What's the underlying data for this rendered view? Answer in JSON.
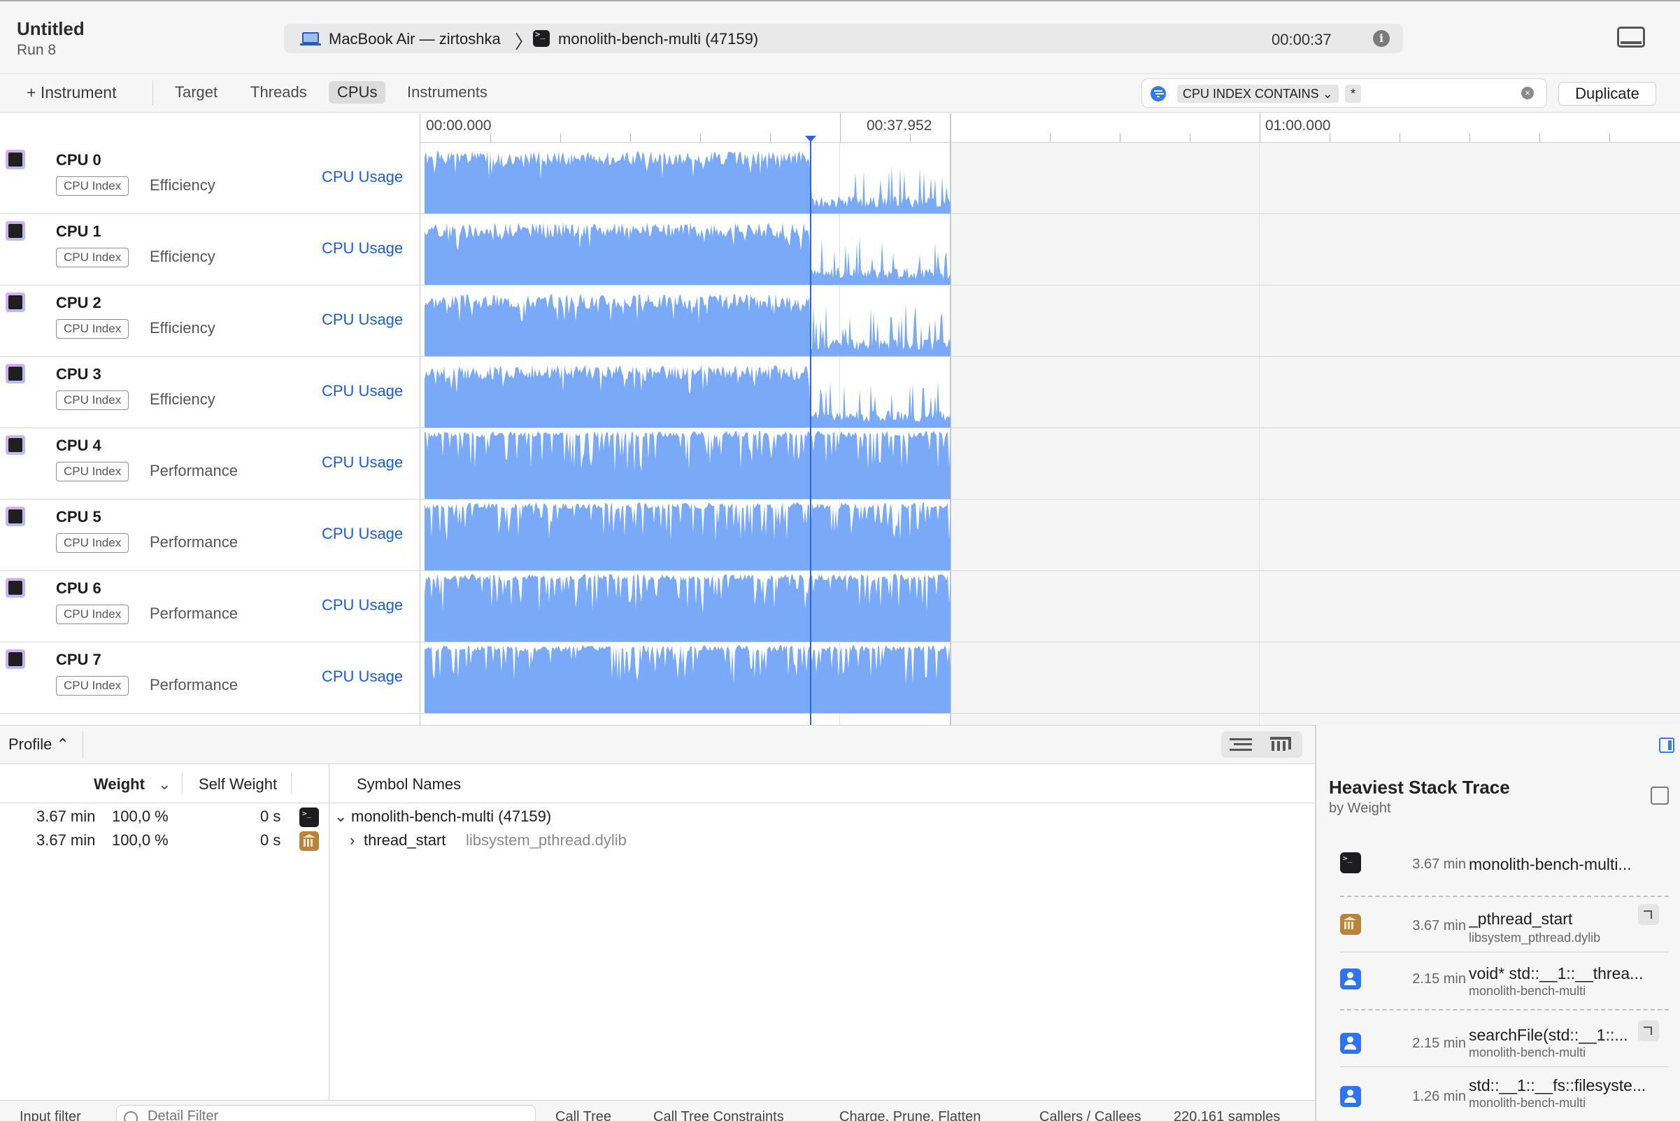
{
  "window": {
    "title": "Untitled",
    "run": "Run 8",
    "device": "MacBook Air — zirtoshka",
    "process": "monolith-bench-multi (47159)",
    "elapsed": "00:00:37"
  },
  "toolbar": {
    "add_instrument": "+ Instrument",
    "tabs": [
      "Target",
      "Threads",
      "CPUs",
      "Instruments"
    ],
    "active_tab": "CPUs",
    "filter_token": "CPU INDEX CONTAINS ⌄",
    "filter_value": "*",
    "duplicate_label": "Duplicate"
  },
  "ruler": {
    "start": "00:00.000",
    "mark": "00:37.952",
    "later": "01:00.000"
  },
  "tracks": [
    {
      "name": "CPU 0",
      "badge": "CPU Index",
      "cluster": "Efficiency",
      "instrument": "CPU Usage"
    },
    {
      "name": "CPU 1",
      "badge": "CPU Index",
      "cluster": "Efficiency",
      "instrument": "CPU Usage"
    },
    {
      "name": "CPU 2",
      "badge": "CPU Index",
      "cluster": "Efficiency",
      "instrument": "CPU Usage"
    },
    {
      "name": "CPU 3",
      "badge": "CPU Index",
      "cluster": "Efficiency",
      "instrument": "CPU Usage"
    },
    {
      "name": "CPU 4",
      "badge": "CPU Index",
      "cluster": "Performance",
      "instrument": "CPU Usage"
    },
    {
      "name": "CPU 5",
      "badge": "CPU Index",
      "cluster": "Performance",
      "instrument": "CPU Usage"
    },
    {
      "name": "CPU 6",
      "badge": "CPU Index",
      "cluster": "Performance",
      "instrument": "CPU Usage"
    },
    {
      "name": "CPU 7",
      "badge": "CPU Index",
      "cluster": "Performance",
      "instrument": "CPU Usage"
    }
  ],
  "colors": {
    "usage_fill": "#7aaaf7",
    "accent": "#2f64d6",
    "instrument_link": "#1a5dd4"
  },
  "detail": {
    "profile_select": "Profile ⌃",
    "columns": {
      "weight": "Weight",
      "self_weight": "Self Weight",
      "symbol_names": "Symbol Names"
    },
    "rows": [
      {
        "weight": "3.67 min",
        "percent": "100,0 %",
        "self": "0 s",
        "icon": "terminal-icon",
        "disclosure": "⌄",
        "symbol": "monolith-bench-multi (47159)",
        "library": ""
      },
      {
        "weight": "3.67 min",
        "percent": "100,0 %",
        "self": "0 s",
        "icon": "library-icon",
        "disclosure": "›",
        "symbol": "thread_start",
        "library": "libsystem_pthread.dylib"
      }
    ]
  },
  "bottom_bar": {
    "input_filter": "Input filter",
    "detail_filter_placeholder": "Detail Filter",
    "call_tree": "Call Tree",
    "constraints": "Call Tree Constraints",
    "charge": "Charge, Prune, Flatten",
    "callers": "Callers / Callees",
    "samples": "220,161 samples"
  },
  "inspector": {
    "title": "Heaviest Stack Trace",
    "subtitle": "by Weight",
    "frames": [
      {
        "icon": "terminal-icon",
        "weight": "3.67 min",
        "symbol": "monolith-bench-multi...",
        "library": ""
      },
      {
        "icon": "library-icon",
        "weight": "3.67 min",
        "symbol": "_pthread_start",
        "library": "libsystem_pthread.dylib"
      },
      {
        "icon": "user-icon",
        "weight": "2.15 min",
        "symbol": "void* std::__1::__threa...",
        "library": "monolith-bench-multi"
      },
      {
        "icon": "user-icon",
        "weight": "2.15 min",
        "symbol": "searchFile(std::__1::...",
        "library": "monolith-bench-multi"
      },
      {
        "icon": "user-icon",
        "weight": "1.26 min",
        "symbol": "std::__1::__fs::filesyste...",
        "library": "monolith-bench-multi"
      }
    ]
  }
}
